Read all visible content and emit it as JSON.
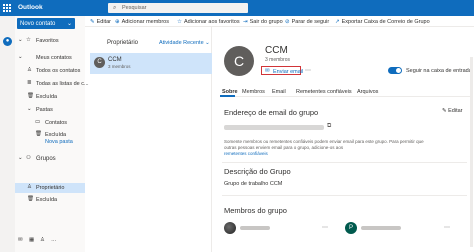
{
  "topbar": {
    "app_title": "Outlook",
    "search_placeholder": "Pesquisar"
  },
  "nav": {
    "new_button": "Novo contato",
    "favorites": "Favoritos",
    "my_contacts": "Meus contatos",
    "all_contacts": "Todos os contatos",
    "all_contact_lists": "Todas as listas de c...",
    "deleted": "Excluída",
    "folders": "Pastas",
    "contacts": "Contatos",
    "deleted2": "Excluída",
    "new_folder": "Nova pasta",
    "groups": "Grupos",
    "owner": "Proprietário",
    "deleted3": "Excluída"
  },
  "toolbar": {
    "edit": "Editar",
    "add_members": "Adicionar membros",
    "add_favorites": "Adicionar aos favoritos",
    "leave_group": "Sair do grupo",
    "stop_following": "Parar de seguir",
    "export_mailbox": "Exportar Caixa de Correio de Grupo"
  },
  "list": {
    "header_col1": "Proprietário",
    "header_col2": "Atividade Recente",
    "item": {
      "initial": "C",
      "name": "CCM",
      "members": "3 membros"
    }
  },
  "detail": {
    "initial": "C",
    "name": "CCM",
    "members": "3 membros",
    "send_email": "Enviar email",
    "follow_inbox": "Seguir na caixa de entrada",
    "tabs": [
      "Sobre",
      "Membros",
      "Email",
      "Remetentes confiáveis",
      "Arquivos"
    ],
    "email_section_title": "Endereço de email do grupo",
    "edit": "Editar",
    "info_text": "Somente membros ou remetentes confiáveis podem enviar email para este grupo. Para permitir que outras pessoas enviem email para o grupo, adicione-os aos",
    "info_link": "remetentes confiáveis",
    "description_title": "Descrição do Grupo",
    "description": "Grupo de trabalho CCM",
    "members_title": "Membros do grupo",
    "member2_initial": "P"
  }
}
